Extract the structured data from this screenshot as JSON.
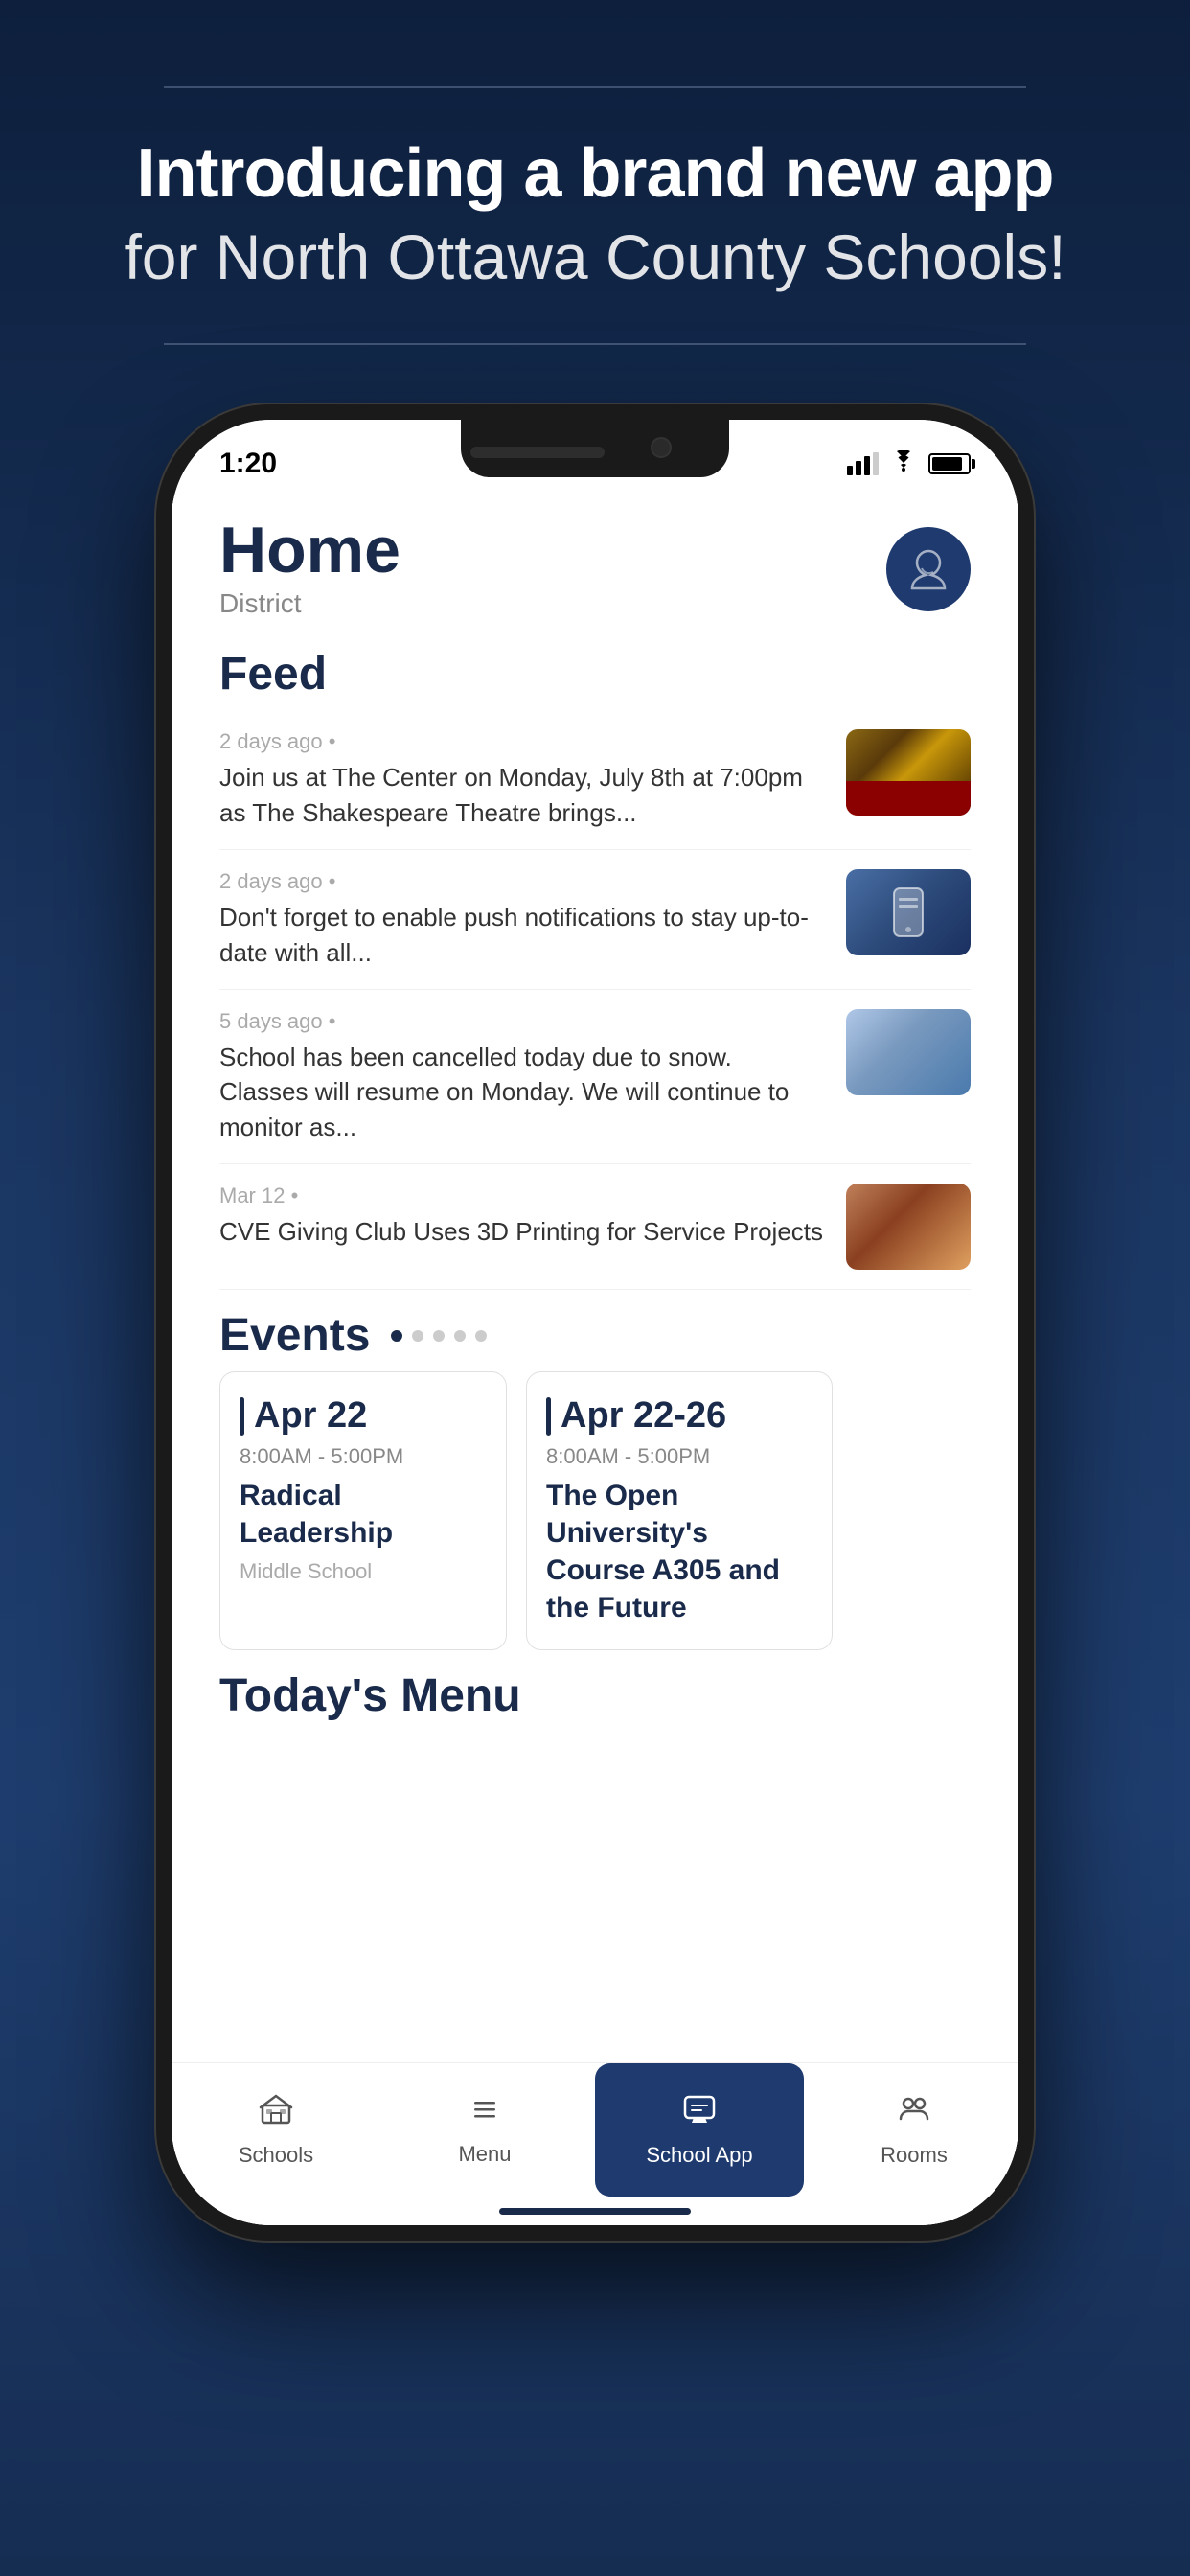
{
  "header": {
    "top_line": true,
    "title_bold": "Introducing a brand new app",
    "title_normal": "for North Ottawa County Schools!",
    "bottom_line": true
  },
  "phone": {
    "status_bar": {
      "time": "1:20",
      "has_location": true
    },
    "app": {
      "page_title": "Home",
      "page_subtitle": "District",
      "feed_label": "Feed",
      "feed_items": [
        {
          "timestamp": "2 days ago",
          "text": "Join us at The Center on Monday, July 8th at 7:00pm as The Shakespeare Theatre brings...",
          "thumb_type": "theater"
        },
        {
          "timestamp": "2 days ago",
          "text": "Don't forget to enable push notifications to stay up-to-date with all...",
          "thumb_type": "phone-hands"
        },
        {
          "timestamp": "5 days ago",
          "text": "School has been cancelled today due to snow. Classes will resume on Monday. We will continue to monitor as...",
          "thumb_type": "snow"
        },
        {
          "timestamp": "Mar 12",
          "text": "CVE Giving Club Uses 3D Printing for Service Projects",
          "thumb_type": "students"
        }
      ],
      "events_label": "Events",
      "events_dots": [
        {
          "active": true
        },
        {
          "active": false
        },
        {
          "active": false
        },
        {
          "active": false
        },
        {
          "active": false
        }
      ],
      "events": [
        {
          "date": "Apr 22",
          "time": "8:00AM - 5:00PM",
          "name": "Radical Leadership",
          "location": "Middle School"
        },
        {
          "date": "Apr 22-26",
          "time": "8:00AM - 5:00PM",
          "name": "The Open University's Course A305 and the Future",
          "location": ""
        }
      ],
      "menu_label": "Today's Menu",
      "nav_items": [
        {
          "id": "schools",
          "label": "Schools",
          "icon": "🏛",
          "active": false
        },
        {
          "id": "menu",
          "label": "Menu",
          "icon": "☰",
          "active": false
        },
        {
          "id": "school-app",
          "label": "School App",
          "icon": "💬",
          "active": true
        },
        {
          "id": "rooms",
          "label": "Rooms",
          "icon": "👥",
          "active": false
        }
      ]
    }
  }
}
